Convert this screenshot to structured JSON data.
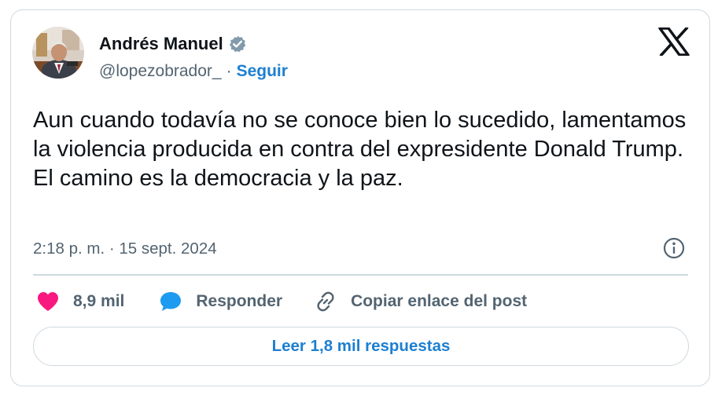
{
  "author": {
    "name": "Andrés Manuel",
    "handle": "@lopezobrador_",
    "separator": "·",
    "follow_label": "Seguir",
    "verified_icon": "verified-badge-icon",
    "avatar": "profile-photo"
  },
  "brand": {
    "logo": "x-logo-icon"
  },
  "tweet": {
    "text": "Aun cuando todavía no se conoce bien lo sucedido, lamentamos la violencia producida en contra del expresidente Donald Trump. El camino es la democracia y la paz.",
    "timestamp": "2:18 p. m. · 15 sept. 2024"
  },
  "actions": {
    "like_count": "8,9 mil",
    "reply_label": "Responder",
    "copy_label": "Copiar enlace del post"
  },
  "read_replies_label": "Leer 1,8 mil respuestas",
  "colors": {
    "accent": "#1d7fd1",
    "like": "#f91880",
    "text_secondary": "#536471",
    "border": "#cfd9de",
    "verified": "#829aab"
  }
}
